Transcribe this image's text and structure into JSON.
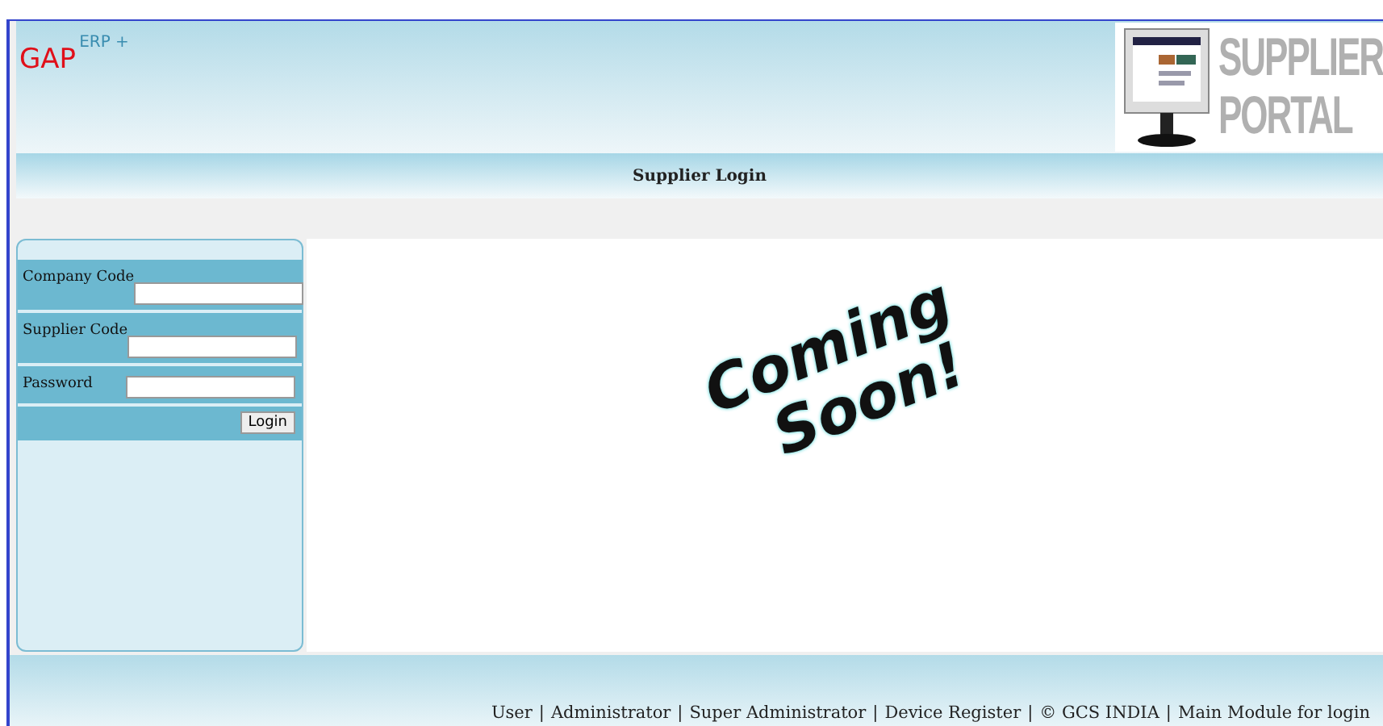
{
  "header": {
    "brand": "GAP",
    "brand_sup": "ERP +",
    "logo_lines": [
      "SUPPLIER",
      "PORTAL"
    ]
  },
  "title_bar": {
    "title": "Supplier Login"
  },
  "login_form": {
    "fields": [
      {
        "label": "Company Code"
      },
      {
        "label": "Supplier Code"
      },
      {
        "label": "Password"
      }
    ],
    "button": "Login"
  },
  "main": {
    "banner_lines": [
      "Coming",
      "Soon!"
    ]
  },
  "footer": {
    "separator": "|",
    "links": [
      "User",
      "Administrator",
      "Super Administrator",
      "Device Register",
      "© GCS INDIA",
      "Main Module for login"
    ]
  }
}
